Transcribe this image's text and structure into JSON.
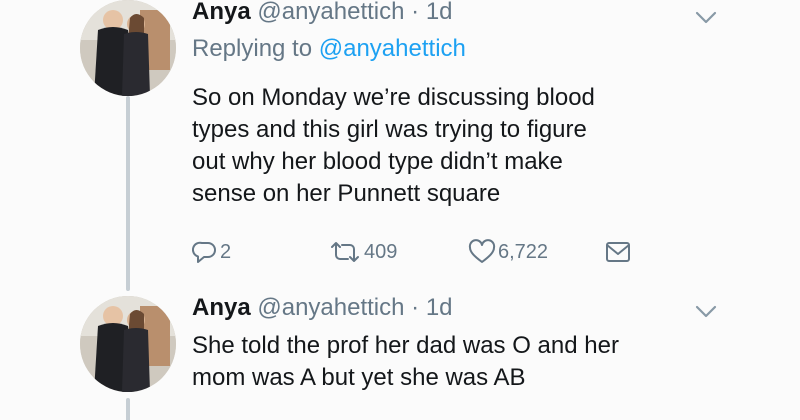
{
  "tweets": [
    {
      "name": "Anya",
      "handle": "@anyahettich",
      "dot": "·",
      "time": "1d",
      "replying_prefix": "Replying to",
      "replying_to": "@anyahettich",
      "body_lines": [
        "So on Monday we’re discussing blood",
        "types and this girl was trying to figure",
        "out why her blood type didn’t make",
        "sense on her Punnett square"
      ],
      "reply_count": "2",
      "retweet_count": "409",
      "like_count": "6,722"
    },
    {
      "name": "Anya",
      "handle": "@anyahettich",
      "dot": "·",
      "time": "1d",
      "body_lines": [
        "She told the prof her dad was O and her",
        "mom was A but yet she was AB"
      ]
    }
  ],
  "colors": {
    "text": "#14171a",
    "secondary": "#657786",
    "link": "#1da1f2",
    "thread_line": "#c6ced4"
  },
  "icons": {
    "reply": "speech-bubble",
    "retweet": "two-arrows-loop",
    "like": "heart-outline",
    "share": "envelope",
    "menu": "chevron-down"
  }
}
